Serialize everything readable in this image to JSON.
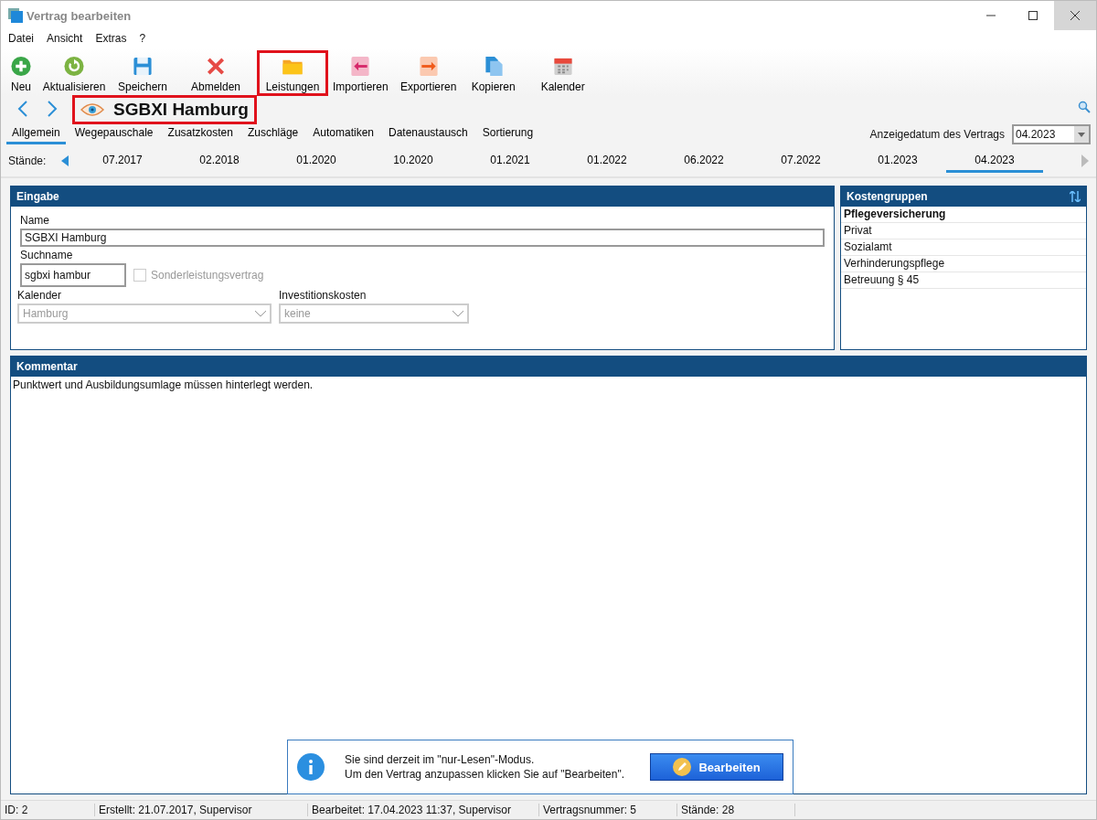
{
  "window": {
    "title": "Vertrag bearbeiten"
  },
  "menu": [
    "Datei",
    "Ansicht",
    "Extras",
    "?"
  ],
  "toolbar": [
    {
      "kind": "add",
      "label": "Neu",
      "highlighted": false
    },
    {
      "kind": "refresh",
      "label": "Aktualisieren",
      "highlighted": false
    },
    {
      "kind": "save",
      "label": "Speichern",
      "highlighted": false
    },
    {
      "kind": "logout",
      "label": "Abmelden",
      "highlighted": false
    },
    {
      "kind": "folder",
      "label": "Leistungen",
      "highlighted": true
    },
    {
      "kind": "import",
      "label": "Importieren",
      "highlighted": false
    },
    {
      "kind": "export",
      "label": "Exportieren",
      "highlighted": false
    },
    {
      "kind": "copy",
      "label": "Kopieren",
      "highlighted": false
    },
    {
      "kind": "calendar",
      "label": "Kalender",
      "highlighted": false
    }
  ],
  "header": {
    "title": "SGBXI Hamburg",
    "highlighted": true
  },
  "tabs": [
    {
      "label": "Allgemein",
      "selected": true
    },
    {
      "label": "Wegepauschale",
      "selected": false
    },
    {
      "label": "Zusatzkosten",
      "selected": false
    },
    {
      "label": "Zuschläge",
      "selected": false
    },
    {
      "label": "Automatiken",
      "selected": false
    },
    {
      "label": "Datenaustausch",
      "selected": false
    },
    {
      "label": "Sortierung",
      "selected": false
    }
  ],
  "display_date": {
    "label": "Anzeigedatum des Vertrags",
    "value": "04.2023"
  },
  "versions": {
    "label": "Stände:",
    "items": [
      {
        "label": "07.2017",
        "selected": false
      },
      {
        "label": "02.2018",
        "selected": false
      },
      {
        "label": "01.2020",
        "selected": false
      },
      {
        "label": "10.2020",
        "selected": false
      },
      {
        "label": "01.2021",
        "selected": false
      },
      {
        "label": "01.2022",
        "selected": false
      },
      {
        "label": "06.2022",
        "selected": false
      },
      {
        "label": "07.2022",
        "selected": false
      },
      {
        "label": "01.2023",
        "selected": false
      },
      {
        "label": "04.2023",
        "selected": true
      }
    ]
  },
  "input_panel": {
    "title": "Eingabe",
    "name_label": "Name",
    "name_value": "SGBXI Hamburg",
    "searchname_label": "Suchname",
    "searchname_value": "sgbxi hambur",
    "special_contract": {
      "label": "Sonderleistungsvertrag",
      "checked": false,
      "disabled": true
    },
    "calendar": {
      "label": "Kalender",
      "value": "Hamburg",
      "disabled": true
    },
    "investment": {
      "label": "Investitionskosten",
      "value": "keine",
      "disabled": true
    }
  },
  "cost_groups": {
    "title": "Kostengruppen",
    "items": [
      {
        "label": "Pflegeversicherung",
        "selected": true
      },
      {
        "label": "Privat",
        "selected": false
      },
      {
        "label": "Sozialamt",
        "selected": false
      },
      {
        "label": "Verhinderungspflege",
        "selected": false
      },
      {
        "label": "Betreuung § 45",
        "selected": false
      }
    ]
  },
  "comment": {
    "title": "Kommentar",
    "text": "Punktwert und Ausbildungsumlage müssen hinterlegt werden."
  },
  "notice": {
    "lines": [
      "Sie sind derzeit im \"nur-Lesen\"-Modus.",
      "Um den Vertrag anzupassen klicken Sie auf \"Bearbeiten\"."
    ],
    "button": "Bearbeiten"
  },
  "status_bar": [
    "ID: 2",
    "Erstellt: 21.07.2017, Supervisor",
    "Bearbeitet: 17.04.2023 11:37, Supervisor",
    "Vertragsnummer: 5",
    "Stände: 28"
  ]
}
